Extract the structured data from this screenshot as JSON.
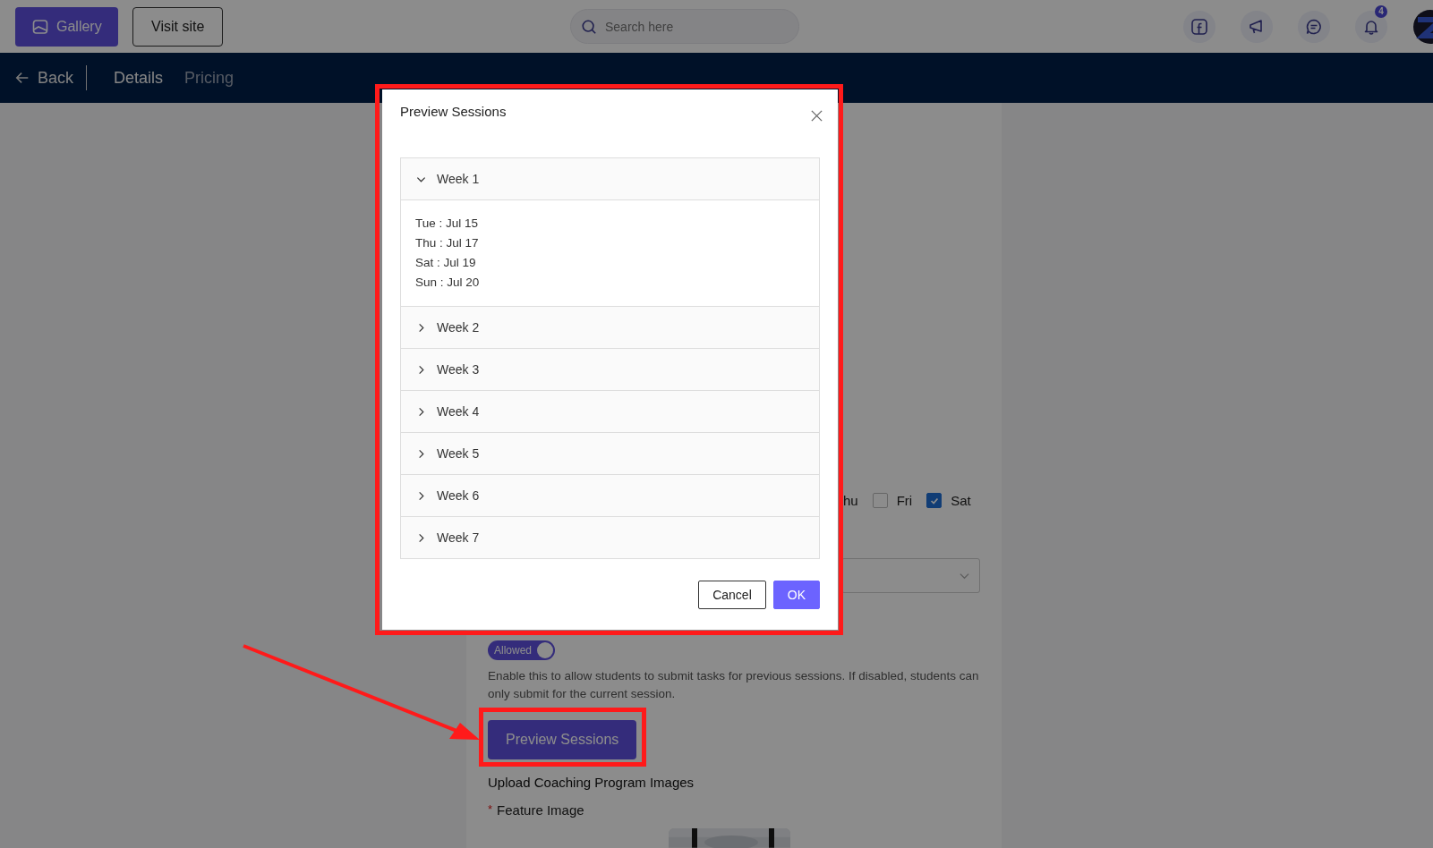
{
  "top_bar": {
    "buttons": [
      {
        "label": "Gallery",
        "kind": "primary"
      },
      {
        "label": "Visit site",
        "kind": "outline"
      }
    ],
    "search": {
      "placeholder": "Search here"
    },
    "notification_count": "4"
  },
  "nav": {
    "back": "Back",
    "tabs": [
      {
        "label": "Details",
        "selected": true
      },
      {
        "label": "Pricing",
        "selected": false
      }
    ]
  },
  "form": {
    "partial_day": "hu",
    "days": [
      {
        "label": "Fri",
        "checked": false
      },
      {
        "label": "Sat",
        "checked": true
      }
    ],
    "toggle": {
      "label": "Allowed",
      "on": true
    },
    "help_text": "Enable this to allow students to submit tasks for previous sessions. If disabled, students can only submit for the current session.",
    "preview_button": "Preview Sessions",
    "section_title": "Upload Coaching Program Images",
    "feature_image": {
      "label": "Feature Image",
      "required_mark": "*",
      "kind": "picture"
    }
  },
  "modal": {
    "title": "Preview Sessions",
    "weeks": [
      {
        "label": "Week 1",
        "expanded": true,
        "sessions": [
          "Tue : Jul 15",
          "Thu : Jul 17",
          "Sat : Jul 19",
          "Sun : Jul 20"
        ]
      },
      {
        "label": "Week 2",
        "expanded": false
      },
      {
        "label": "Week 3",
        "expanded": false
      },
      {
        "label": "Week 4",
        "expanded": false
      },
      {
        "label": "Week 5",
        "expanded": false
      },
      {
        "label": "Week 6",
        "expanded": false
      },
      {
        "label": "Week 7",
        "expanded": false
      }
    ],
    "buttons": [
      {
        "label": "Cancel",
        "kind": "default"
      },
      {
        "label": "OK",
        "kind": "primary"
      }
    ]
  }
}
